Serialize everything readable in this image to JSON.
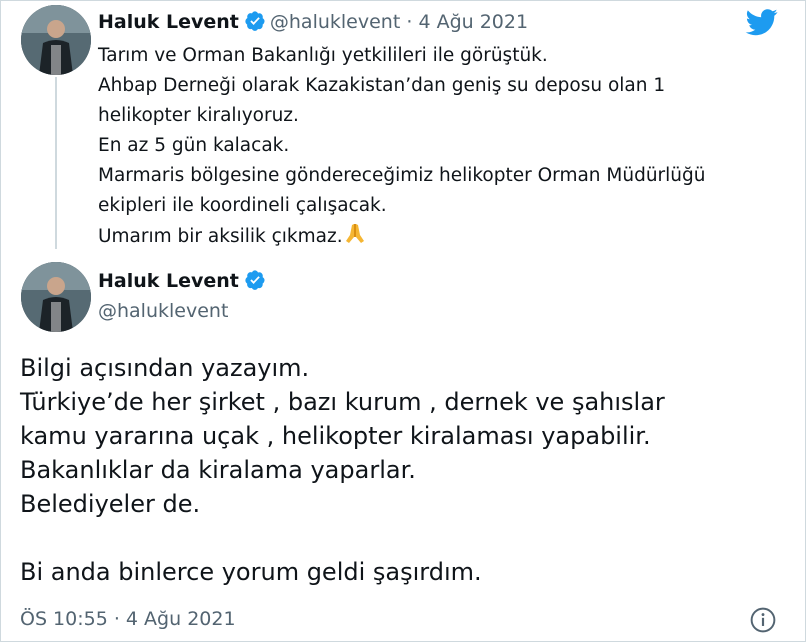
{
  "quoted_tweet": {
    "name": "Haluk Levent",
    "handle": "@haluklevent",
    "separator": "·",
    "date": "4 Ağu 2021",
    "lines": [
      "Tarım ve Orman Bakanlığı yetkilileri ile görüştük.",
      "Ahbap Derneği olarak Kazakistan’dan geniş su deposu olan 1",
      "helikopter kiralıyoruz.",
      "En az 5 gün kalacak.",
      "Marmaris bölgesine göndereceğimiz helikopter Orman Müdürlüğü",
      "ekipleri ile koordineli çalışacak.",
      "Umarım bir aksilik çıkmaz."
    ],
    "emoji": "folded-hands-icon"
  },
  "main_tweet": {
    "name": "Haluk Levent",
    "handle": "@haluklevent",
    "lines": [
      "Bilgi açısından yazayım.",
      "Türkiye’de her şirket , bazı kurum , dernek ve şahıslar",
      "kamu yararına uçak , helikopter kiralaması yapabilir.",
      "Bakanlıklar da kiralama yaparlar.",
      "Belediyeler de.",
      "",
      "Bi anda binlerce yorum geldi şaşırdım."
    ],
    "timestamp": "ÖS 10:55 · 4 Ağu 2021"
  },
  "colors": {
    "twitter_blue": "#1d9bf0",
    "text": "#0f1419",
    "secondary": "#536471",
    "border": "#cfd9de"
  }
}
